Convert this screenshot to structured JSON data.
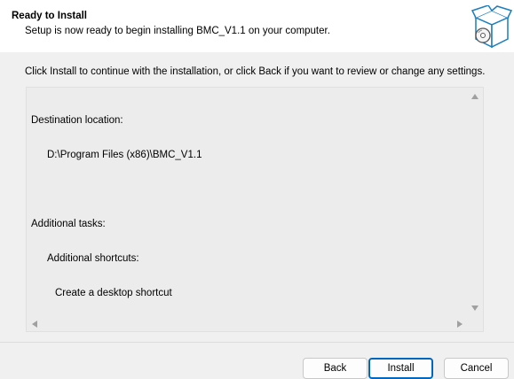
{
  "header": {
    "title": "Ready to Install",
    "subtitle": "Setup is now ready to begin installing BMC_V1.1 on your computer.",
    "icon": "setup-box-icon"
  },
  "instruction": "Click Install to continue with the installation, or click Back if you want to review or change any settings.",
  "memo": {
    "destination_label": "Destination location:",
    "destination_path": "D:\\Program Files (x86)\\BMC_V1.1",
    "tasks_label": "Additional tasks:",
    "shortcuts_label": "Additional shortcuts:",
    "shortcut_item": "Create a desktop shortcut"
  },
  "buttons": {
    "back": "Back",
    "install": "Install",
    "cancel": "Cancel"
  },
  "colors": {
    "accent": "#0067c0",
    "header_bg": "#ffffff",
    "body_bg": "#f0f0f0"
  }
}
